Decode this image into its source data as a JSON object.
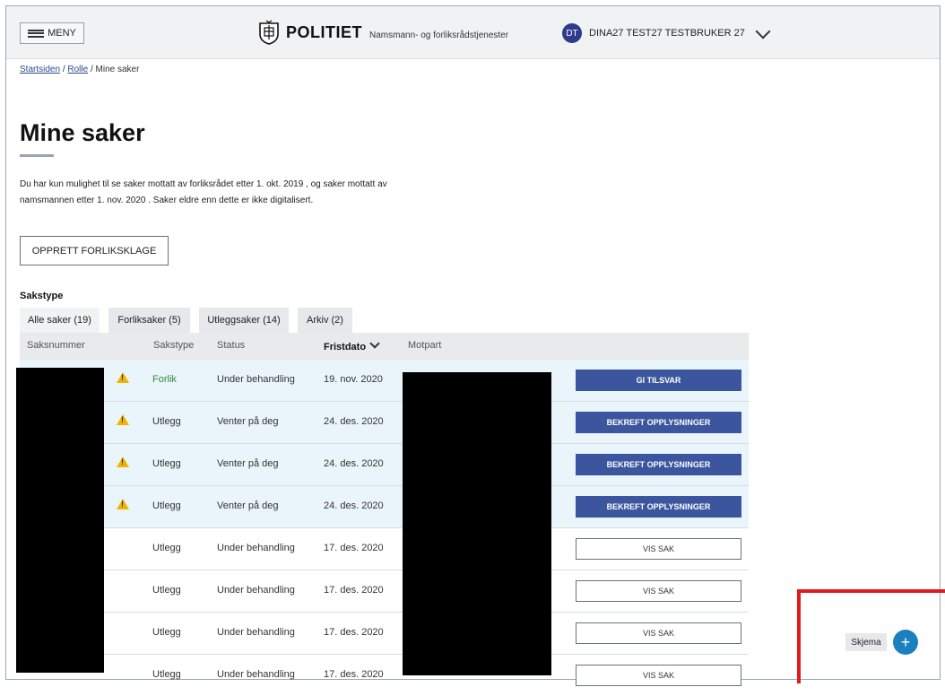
{
  "header": {
    "menu_label": "MENY",
    "brand": "POLITIET",
    "brand_sub": "Namsmann- og forliksrådstjenester",
    "user_initials": "DT",
    "user_name": "DINA27 TEST27 TESTBRUKER 27"
  },
  "breadcrumb": {
    "items": [
      "Startsiden",
      "Rolle"
    ],
    "current": "Mine saker",
    "separator": "/"
  },
  "page": {
    "title": "Mine saker",
    "intro_line1": "Du har kun mulighet til se saker mottatt av forliksrådet etter 1. okt. 2019 , og saker mottatt av",
    "intro_line2": "namsmannen etter 1. nov. 2020 . Saker eldre enn dette er ikke digitalisert.",
    "create_button": "OPPRETT FORLIKSKLAGE",
    "sakstype_label": "Sakstype"
  },
  "tabs": [
    {
      "label": "Alle saker (19)",
      "active": true
    },
    {
      "label": "Forliksaker (5)",
      "active": false
    },
    {
      "label": "Utleggsaker (14)",
      "active": false
    },
    {
      "label": "Arkiv (2)",
      "active": false
    }
  ],
  "table": {
    "columns": [
      "Saksnummer",
      "Sakstype",
      "Status",
      "Fristdato",
      "Motpart"
    ],
    "rows": [
      {
        "warning": true,
        "type": "Forlik",
        "type_color": "#2e8b3a",
        "status": "Under behandling",
        "date": "19. nov. 2020",
        "action": "GI TILSVAR",
        "action_style": "primary"
      },
      {
        "warning": true,
        "type": "Utlegg",
        "status": "Venter på deg",
        "date": "24. des. 2020",
        "action": "BEKREFT OPPLYSNINGER",
        "action_style": "primary"
      },
      {
        "warning": true,
        "type": "Utlegg",
        "status": "Venter på deg",
        "date": "24. des. 2020",
        "action": "BEKREFT OPPLYSNINGER",
        "action_style": "primary"
      },
      {
        "warning": true,
        "type": "Utlegg",
        "status": "Venter på deg",
        "date": "24. des. 2020",
        "action": "BEKREFT OPPLYSNINGER",
        "action_style": "primary"
      },
      {
        "warning": false,
        "type": "Utlegg",
        "status": "Under behandling",
        "date": "17. des. 2020",
        "action": "VIS SAK",
        "action_style": "secondary"
      },
      {
        "warning": false,
        "type": "Utlegg",
        "status": "Under behandling",
        "date": "17. des. 2020",
        "action": "VIS SAK",
        "action_style": "secondary"
      },
      {
        "warning": false,
        "type": "Utlegg",
        "status": "Under behandling",
        "date": "17. des. 2020",
        "action": "VIS SAK",
        "action_style": "secondary"
      },
      {
        "warning": false,
        "type": "Utlegg",
        "status": "Under behandling",
        "date": "17. des. 2020",
        "action": "VIS SAK",
        "action_style": "secondary"
      }
    ]
  },
  "widget": {
    "skjema_label": "Skjema",
    "plus_icon": "+"
  },
  "colors": {
    "primary": "#3b569e",
    "alert_row": "#eaf4fb",
    "warning": "#f0b400",
    "highlight": "#e01b1b",
    "fab": "#1c7fc0"
  }
}
